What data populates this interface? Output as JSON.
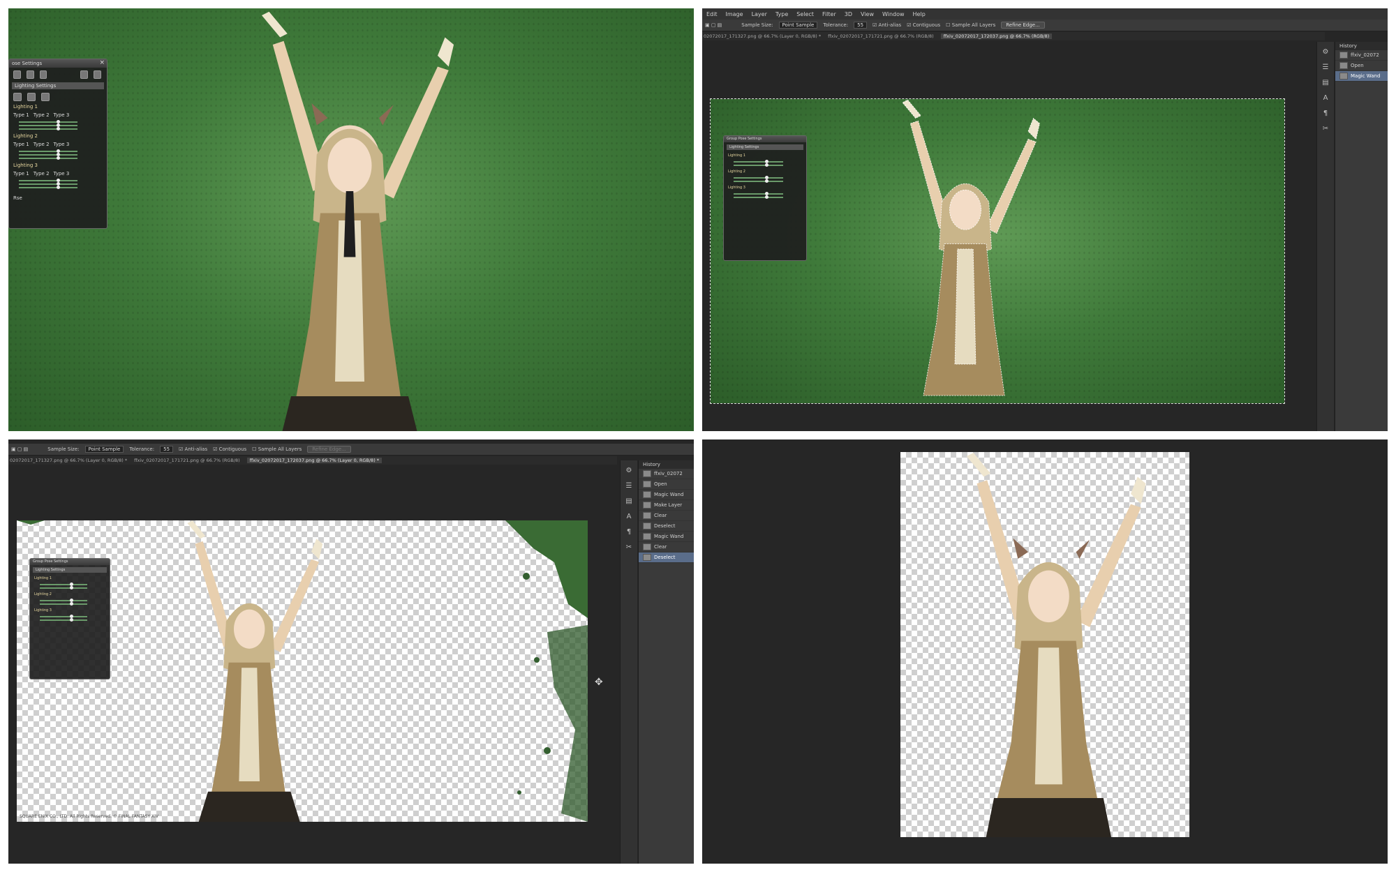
{
  "game_panel": {
    "title_partial": "ose Settings",
    "title_full": "Group Pose Settings",
    "section": "Lighting Settings",
    "lightings": [
      {
        "label": "Lighting 1",
        "types": [
          "Type 1",
          "Type 2",
          "Type 3"
        ]
      },
      {
        "label": "Lighting 2",
        "types": [
          "Type 1",
          "Type 2",
          "Type 3"
        ]
      },
      {
        "label": "Lighting 3",
        "types": [
          "Type 1",
          "Type 2",
          "Type 3"
        ]
      }
    ],
    "slider_values": [
      "5",
      "5",
      "5"
    ],
    "reset_label": "Rse"
  },
  "photoshop": {
    "menu": [
      "Edit",
      "Image",
      "Layer",
      "Type",
      "Select",
      "Filter",
      "3D",
      "View",
      "Window",
      "Help"
    ],
    "options": {
      "sample_size_label": "Sample Size:",
      "sample_size_value": "Point Sample",
      "tolerance_label": "Tolerance:",
      "tolerance_value": "55",
      "anti_alias": "Anti-alias",
      "contiguous": "Contiguous",
      "sample_all_layers": "Sample All Layers",
      "refine_edge": "Refine Edge..."
    },
    "tabs": [
      "02072017_171327.png @ 66.7% (Layer 0, RGB/8) *",
      "ffxiv_02072017_171721.png @ 66.7% (RGB/8)",
      "ffxiv_02072017_172037.png @ 66.7% (RGB/8)"
    ],
    "tabs_b": [
      "02072017_171327.png @ 66.7% (Layer 0, RGB/8) *",
      "ffxiv_02072017_171721.png @ 66.7% (RGB/8)",
      "ffxiv_02072017_172037.png @ 66.7% (Layer 0, RGB/8) *"
    ],
    "history_title": "History",
    "history_snapshot": "ffxiv_02072",
    "history_a": [
      "Open",
      "Magic Wand"
    ],
    "history_b": [
      "Open",
      "Magic Wand",
      "Make Layer",
      "Clear",
      "Deselect",
      "Magic Wand",
      "Clear",
      "Deselect"
    ],
    "watermark": "SQUARE ENIX CO., LTD. All Rights Reserved. © FINAL FANTASY XIV"
  },
  "colors": {
    "ps_bg": "#262626",
    "green_bg": "#3f7a3a",
    "selected_history": "#5a6d8a"
  }
}
